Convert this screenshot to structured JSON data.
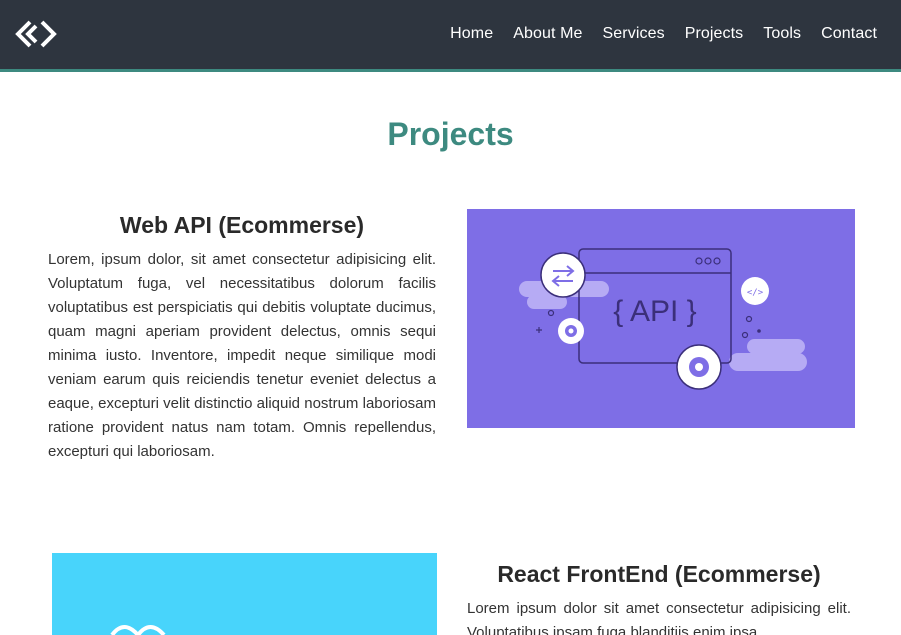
{
  "nav": {
    "logo_icon": "diamond-code-logo-icon",
    "links": [
      "Home",
      "About Me",
      "Services",
      "Projects",
      "Tools",
      "Contact"
    ]
  },
  "page": {
    "title": "Projects"
  },
  "projects": [
    {
      "title": "Web API (Ecommerse)",
      "description": "Lorem, ipsum dolor, sit amet consectetur adipisicing elit. Voluptatum fuga, vel necessitatibus dolorum facilis voluptatibus est perspiciatis qui debitis voluptate ducimus, quam magni aperiam provident delectus, omnis sequi minima iusto. Inventore, impedit neque similique modi veniam earum quis reiciendis tenetur eveniet delectus a eaque, excepturi velit distinctio aliquid nostrum laboriosam ratione provident natus nam totam. Omnis repellendus, excepturi qui laboriosam.",
      "image_label": "{ API }",
      "image_color": "#7e6ee6"
    },
    {
      "title": "React FrontEnd (Ecommerse)",
      "description": "Lorem ipsum dolor sit amet consectetur adipisicing elit. Voluptatibus ipsam fuga blanditiis enim ipsa",
      "image_color": "#48d4fb"
    }
  ],
  "colors": {
    "navbar": "#2e353f",
    "accent": "#3d8a80"
  }
}
